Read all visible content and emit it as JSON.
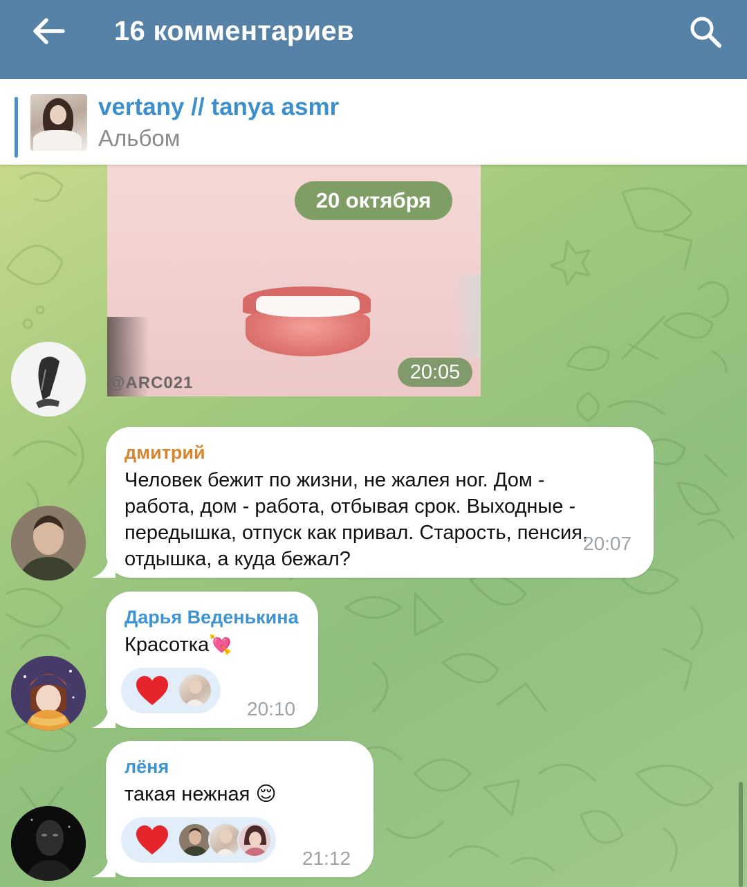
{
  "header": {
    "title": "16 комментариев",
    "back_icon": "arrow-left-icon",
    "search_icon": "search-icon",
    "color": "#5682a8"
  },
  "pinned": {
    "channel_name": "vertany // tanya asmr",
    "subtitle": "Альбом",
    "accent": "#4a90cf"
  },
  "chat": {
    "date_label": "20 октября",
    "photo": {
      "watermark": "@ARC021",
      "time": "20:05"
    },
    "messages": [
      {
        "author": "дмитрий",
        "author_color": "#d9842f",
        "lines": [
          "Человек бежит по жизни, не жалея ног. Дом -",
          "работа, дом - работа, отбывая срок. Выходные -",
          "передышка, отпуск как привал. Старость, пенсия,",
          "отдышка, а куда бежал?"
        ],
        "time": "20:07"
      },
      {
        "author": "Дарья Веденькина",
        "author_color": "#3e94d1",
        "text": "Красотка",
        "emoji": "💘",
        "reaction": "❤",
        "time": "20:10"
      },
      {
        "author": "лёня",
        "author_color": "#3e94d1",
        "text": "такая нежная",
        "emoji": "😌",
        "reaction": "❤",
        "time": "21:12"
      }
    ]
  }
}
